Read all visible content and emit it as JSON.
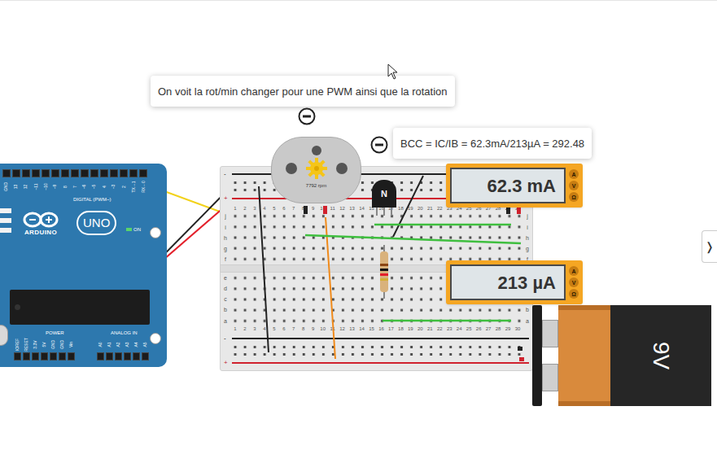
{
  "annotations": [
    {
      "text": "On voit la rot/min changer pour une PWM ainsi que la rotation"
    },
    {
      "text": "BCC = IC/IB = 62.3mA/213µA = 292.48"
    }
  ],
  "motor": {
    "rpm": "7792 rpm"
  },
  "transistor": {
    "label": "N"
  },
  "multimeters": [
    {
      "reading": "62.3 mA",
      "modes": [
        "A",
        "V",
        "Ω"
      ]
    },
    {
      "reading": "213 µA",
      "modes": [
        "A",
        "V",
        "Ω"
      ]
    }
  ],
  "battery": {
    "label": "9V"
  },
  "arduino": {
    "digital_pins": [
      "GND",
      "13",
      "12",
      "~11",
      "~10",
      "~9",
      "8",
      "7",
      "~6",
      "~5",
      "4",
      "~3",
      "2",
      "TX→1",
      "RX←0"
    ],
    "digital_label": "DIGITAL (PWM~)",
    "logo": "ARDUINO",
    "model": "UNO",
    "on_label": "ON",
    "power_label": "POWER",
    "power_pins": [
      "IOREF",
      "RESET",
      "3.3V",
      "5V",
      "GND",
      "GND",
      "Vin"
    ],
    "analog_label": "ANALOG IN",
    "analog_pins": [
      "A0",
      "A1",
      "A2",
      "A3",
      "A4",
      "A5"
    ]
  },
  "breadboard": {
    "rows_top": [
      "j",
      "i",
      "h",
      "g",
      "f"
    ],
    "rows_bottom": [
      "e",
      "d",
      "c",
      "b",
      "a"
    ],
    "columns": [
      "1",
      "2",
      "3",
      "4",
      "5",
      "6",
      "7",
      "8",
      "9",
      "10",
      "11",
      "12",
      "13",
      "14",
      "15",
      "16",
      "17",
      "18",
      "19",
      "20",
      "21",
      "22",
      "23",
      "24",
      "25",
      "26",
      "27",
      "28",
      "29",
      "30"
    ],
    "rail_signs": [
      "-",
      "+"
    ]
  },
  "side_toggle": "❭"
}
